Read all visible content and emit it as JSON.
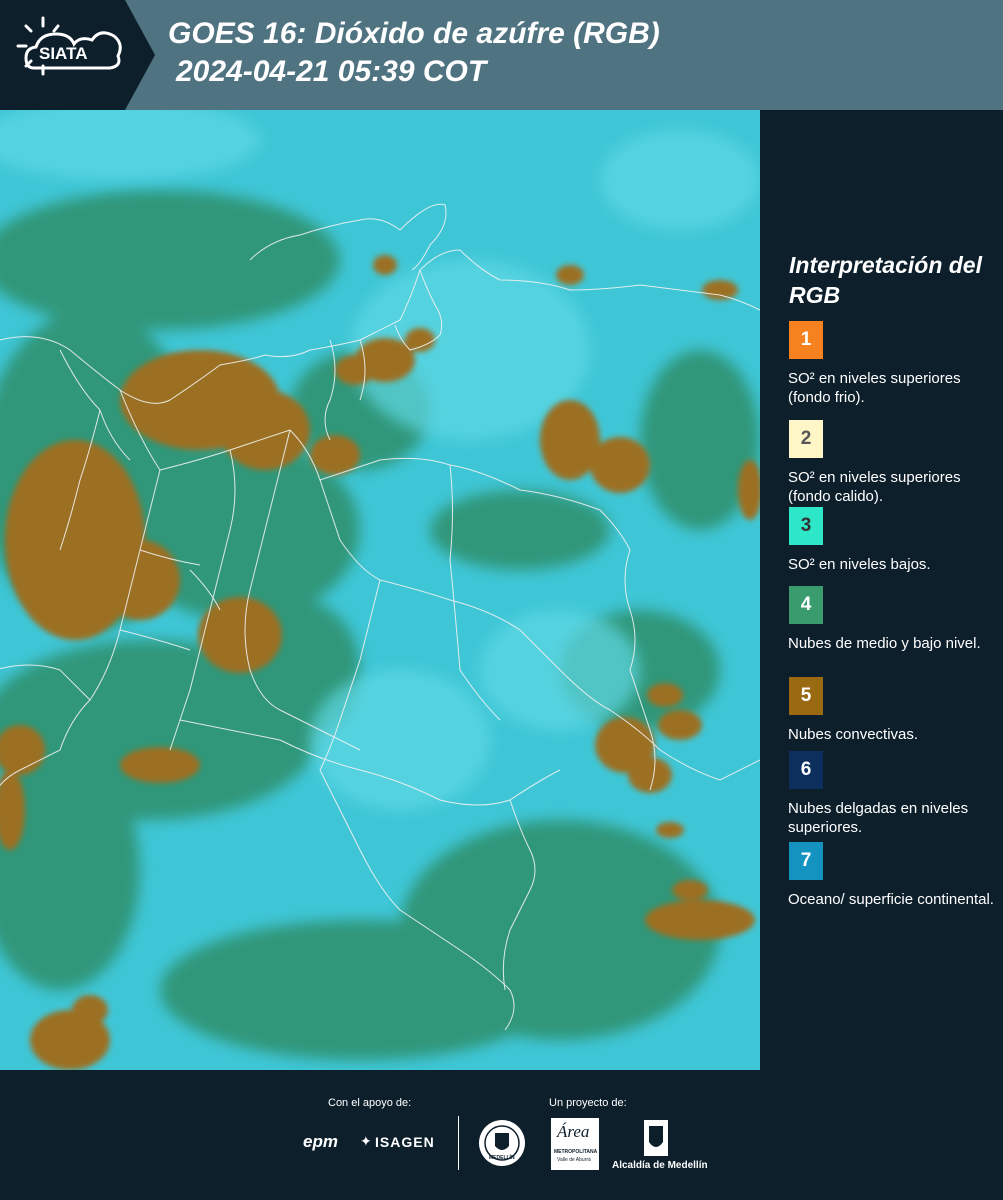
{
  "header": {
    "logo_text": "SIATA",
    "title": "GOES 16: Dióxido de azúfre (RGB)",
    "subtitle": "2024-04-21 05:39 COT",
    "logo_icon": "sun-cloud-icon"
  },
  "legend": {
    "title": "Interpretación del RGB",
    "items": [
      {
        "number": "1",
        "label": "SO² en niveles superiores (fondo frio).",
        "color": "#f5821f",
        "text_color": "#ffffff"
      },
      {
        "number": "2",
        "label": "SO² en niveles superiores (fondo calido).",
        "color": "#fff6c8",
        "text_color": "#555555"
      },
      {
        "number": "3",
        "label": "SO² en niveles bajos.",
        "color": "#2ee6c8",
        "text_color": "#333333"
      },
      {
        "number": "4",
        "label": "Nubes de medio y bajo nivel.",
        "color": "#3a9b6e",
        "text_color": "#ffffff"
      },
      {
        "number": "5",
        "label": "Nubes convectivas.",
        "color": "#9a6a12",
        "text_color": "#ffffff"
      },
      {
        "number": "6",
        "label": "Nubes delgadas en niveles superiores.",
        "color": "#0c2f5e",
        "text_color": "#ffffff"
      },
      {
        "number": "7",
        "label": "Oceano/ superficie continental.",
        "color": "#1593c0",
        "text_color": "#ffffff"
      }
    ]
  },
  "footer": {
    "support_label": "Con el apoyo de:",
    "project_label": "Un proyecto de:",
    "sponsors": [
      "epm",
      "ISAGEN"
    ],
    "partners": [
      "MEDELLÍN",
      "Área METROPOLITANA Valle de Aburrá",
      "Alcaldía de Medellín"
    ],
    "partner_seal_text": "Área",
    "partner_seal_sub": "METROPOLITANA",
    "partner_seal_sub2": "Valle de Aburrá"
  }
}
